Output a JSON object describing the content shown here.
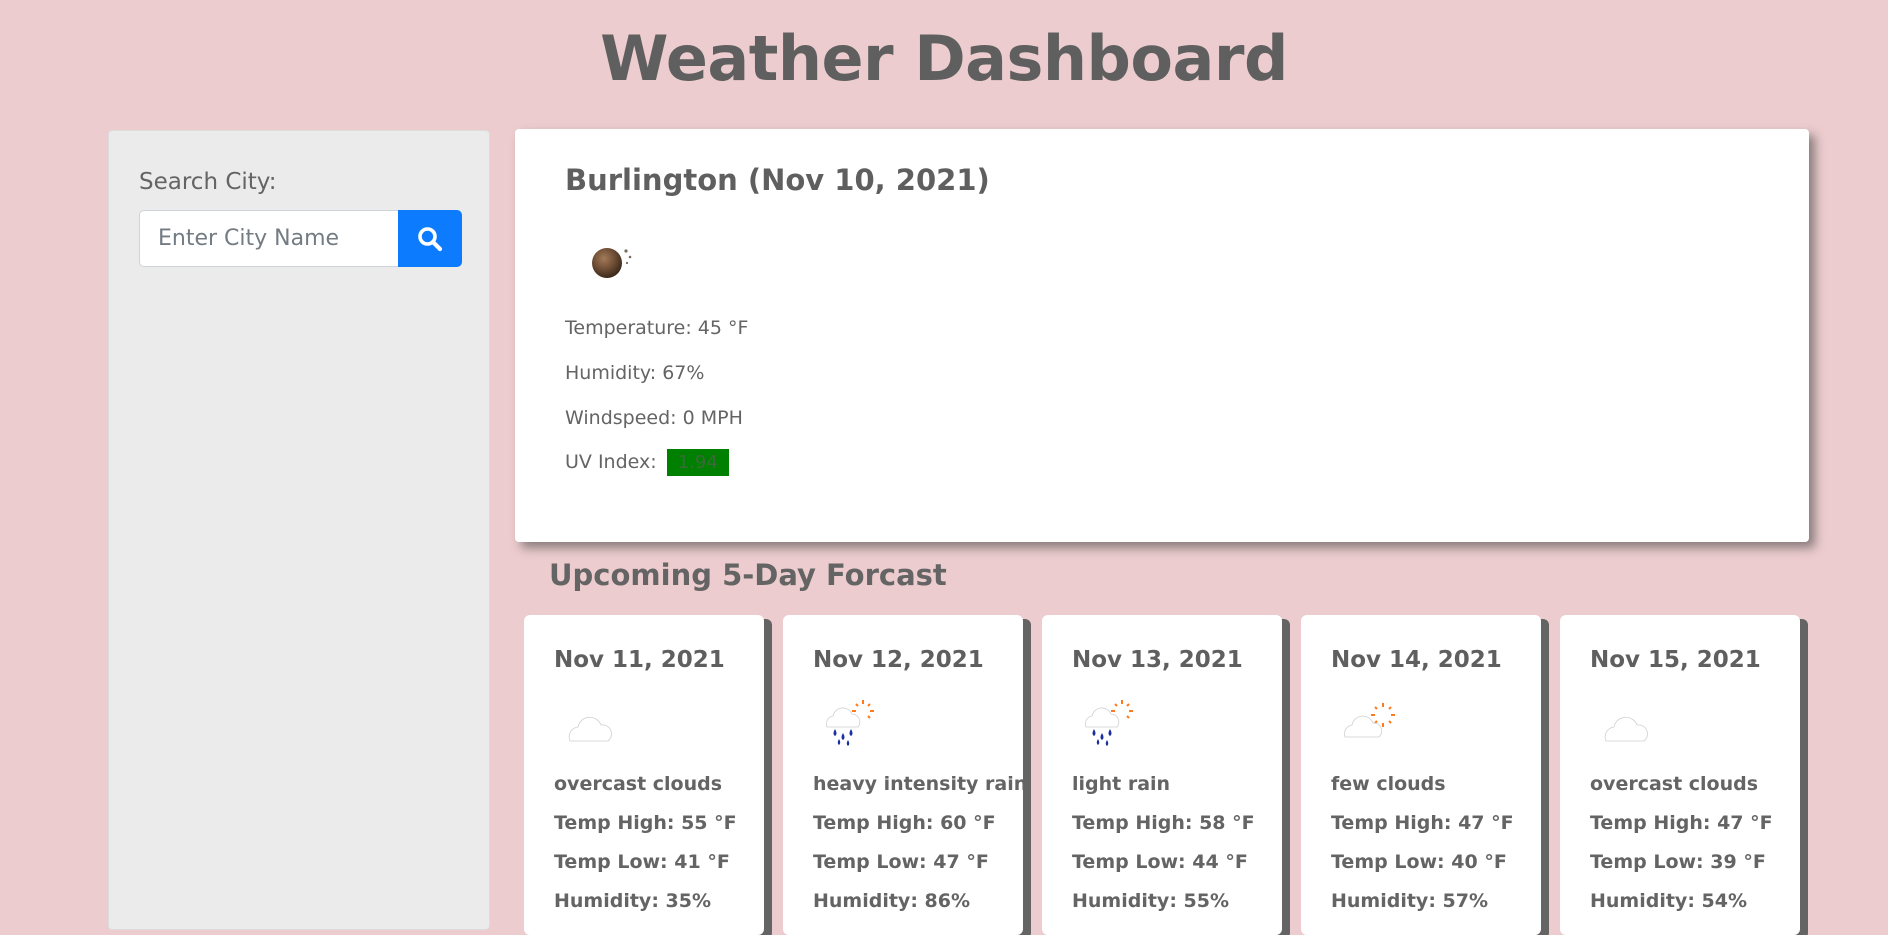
{
  "header": {
    "title": "Weather Dashboard"
  },
  "sidebar": {
    "search_label": "Search City:",
    "search_placeholder": "Enter City Name",
    "search_value": "",
    "search_button_icon": "search-icon"
  },
  "current": {
    "title": "Burlington (Nov 10, 2021)",
    "icon": "clear-night-icon",
    "temperature": "Temperature: 45 °F",
    "humidity": "Humidity: 67%",
    "windspeed": "Windspeed: 0 MPH",
    "uv_label": "UV Index:",
    "uv_value": "1.94",
    "uv_color": "#008000"
  },
  "forecast": {
    "title": "Upcoming 5-Day Forcast",
    "days": [
      {
        "date": "Nov 11, 2021",
        "icon": "overcast-clouds-icon",
        "description": "overcast clouds",
        "high": "Temp High: 55 °F",
        "low": "Temp Low: 41 °F",
        "humidity": "Humidity: 35%"
      },
      {
        "date": "Nov 12, 2021",
        "icon": "rain-sun-icon",
        "description": "heavy intensity rain",
        "high": "Temp High: 60 °F",
        "low": "Temp Low: 47 °F",
        "humidity": "Humidity: 86%"
      },
      {
        "date": "Nov 13, 2021",
        "icon": "rain-sun-icon",
        "description": "light rain",
        "high": "Temp High: 58 °F",
        "low": "Temp Low: 44 °F",
        "humidity": "Humidity: 55%"
      },
      {
        "date": "Nov 14, 2021",
        "icon": "few-clouds-icon",
        "description": "few clouds",
        "high": "Temp High: 47 °F",
        "low": "Temp Low: 40 °F",
        "humidity": "Humidity: 57%"
      },
      {
        "date": "Nov 15, 2021",
        "icon": "overcast-clouds-icon",
        "description": "overcast clouds",
        "high": "Temp High: 47 °F",
        "low": "Temp Low: 39 °F",
        "humidity": "Humidity: 54%"
      }
    ]
  },
  "colors": {
    "page_background": "#ecccce",
    "sidebar_background": "#ebebeb",
    "accent_button": "#0d7bfd",
    "text": "#646464"
  }
}
